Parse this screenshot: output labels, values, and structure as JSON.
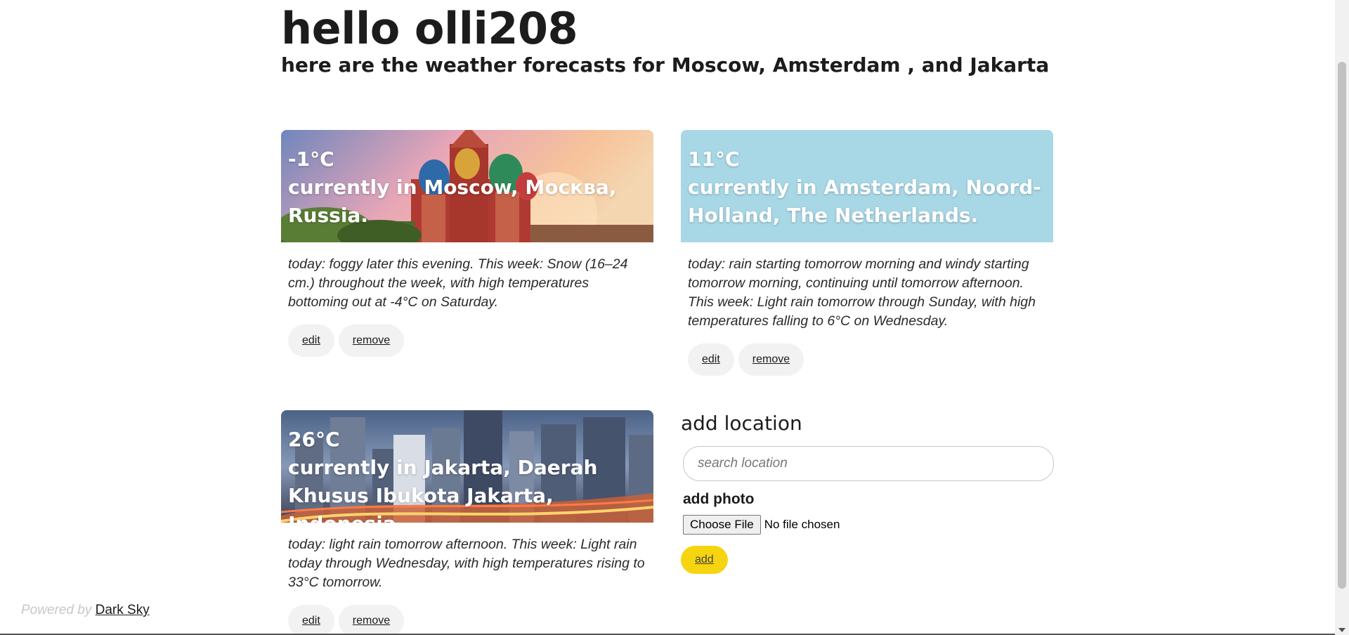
{
  "header": {
    "greeting": "hello olli208",
    "subtitle": "here are the weather forecasts for Moscow, Amsterdam , and Jakarta"
  },
  "cards": [
    {
      "temp": "-1°C",
      "location": "currently in Moscow, Москва, Russia.",
      "description": "today: foggy later this evening. This week: Snow (16–24 cm.) throughout the week, with high temperatures bottoming out at -4°C on Saturday.",
      "edit_label": "edit",
      "remove_label": "remove"
    },
    {
      "temp": "11°C",
      "location": "currently in Amsterdam, Noord-Holland, The Netherlands.",
      "description": "today: rain starting tomorrow morning and windy starting tomorrow morning, continuing until tomorrow afternoon. This week: Light rain tomorrow through Sunday, with high temperatures falling to 6°C on Wednesday.",
      "edit_label": "edit",
      "remove_label": "remove",
      "banner_color": "#a8d8e6"
    },
    {
      "temp": "26°C",
      "location": "currently in Jakarta, Daerah Khusus Ibukota Jakarta, Indonesia.",
      "description": "today: light rain tomorrow afternoon. This week: Light rain today through Wednesday, with high temperatures rising to 33°C tomorrow.",
      "edit_label": "edit",
      "remove_label": "remove"
    }
  ],
  "add_location": {
    "title": "add location",
    "search_placeholder": "search location",
    "photo_label": "add photo",
    "file_button": "Choose File",
    "file_status": "No file chosen",
    "add_label": "add",
    "accent": "#f6d510"
  },
  "footer": {
    "powered_prefix": "Powered by",
    "powered_link": "Dark Sky"
  }
}
